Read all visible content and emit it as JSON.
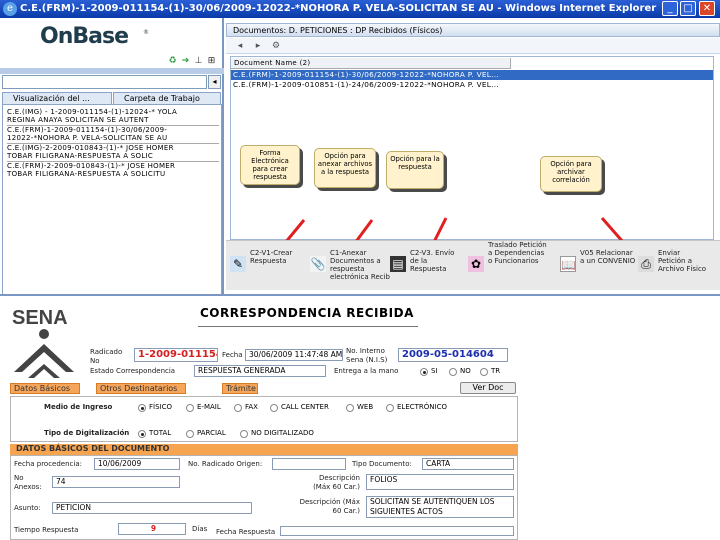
{
  "window": {
    "title": "C.E.(FRM)-1-2009-011154-(1)-30/06/2009-12022-*NOHORA P. VELA-SOLICITAN SE AU - Windows Internet Explorer",
    "icon": "ie-icon",
    "minimize": "_",
    "maximize": "□",
    "close": "✕"
  },
  "left_panel": {
    "logo": "OnBase",
    "logo_tm": "®",
    "toolbar_icons": [
      "recycle-icon",
      "arrow-right-icon",
      "doc-sort-icon",
      "pin-icon"
    ],
    "tabs": [
      "Visualización del ...",
      "Carpeta de Trabajo"
    ],
    "items": [
      [
        "C.E.(IMG) - 1-2009-011154-(1)-12024-* YOLA",
        "REGINA ANAYA SOLICITAN SE AUTENT"
      ],
      [
        "C.E.(FRM)-1-2009-011154-(1)-30/06/2009-",
        "12022-*NOHORA P. VELA-SOLICITAN SE AU"
      ],
      [
        "C.E.(IMG)-2-2009-010843-(1)-* JOSE HOMER",
        "TOBAR FILIGRANA-RESPUESTA A SOLIC"
      ],
      [
        "C.E.(FRM)-2-2009-010843-(1)-* JOSE HOMER",
        "TOBAR FILIGRANA-RESPUESTA A SOLICITU"
      ]
    ]
  },
  "right_panel": {
    "title": "Documentos: D. PETICIONES : DP Recibidos (Físicos)",
    "toolbar_icons": [
      "back-icon",
      "forward-icon",
      "settings-icon"
    ],
    "column_header": "Document Name (2)",
    "rows": [
      "C.E.(FRM)-1-2009-011154-(1)-30/06/2009-12022-*NOHORA P. VEL...",
      "C.E.(FRM)-1-2009-010851-(1)-24/06/2009-12022-*NOHORA P. VEL..."
    ],
    "callouts": [
      "Forma Electrónica para crear respuesta",
      "Opción para anexar archivos a la respuesta",
      "Opción para la respuesta",
      "Opción para archivar correlación"
    ],
    "actions": [
      {
        "label": "C2-V1-Crear Respuesta",
        "icon": "create-response-icon"
      },
      {
        "label": "C1-Anexar Documentos a respuesta electrónica Recib",
        "icon": "attach-icon"
      },
      {
        "label": "C2-V3. Envío de la Respuesta",
        "icon": "send-icon"
      },
      {
        "label": "Traslado Petición a Dependencias o Funcionarios",
        "icon": "transfer-icon"
      },
      {
        "label": "V05 Relacionar a un CONVENIO",
        "icon": "book-icon"
      },
      {
        "label": "Enviar Petición a Archivo Físico",
        "icon": "archive-icon"
      }
    ]
  },
  "form": {
    "org": "SENA",
    "title": "CORRESPONDENCIA RECIBIDA",
    "radicado_label": "Radicado No",
    "radicado_value": "1-2009-011154",
    "fecha_label": "Fecha",
    "fecha_value": "30/06/2009 11:47:48 AM",
    "interno_label": "No. Interno Sena (N.I.S)",
    "interno_value": "2009-05-014604",
    "estado_label": "Estado Correspondencia",
    "estado_value": "RESPUESTA GENERADA",
    "entrega_label": "Entrega a la mano",
    "entrega_opts": [
      "SI",
      "NO",
      "TR"
    ],
    "tabs": [
      "Datos Básicos",
      "Otros Destinatarios",
      "Trámite"
    ],
    "ver_doc": "Ver Doc",
    "medio_label": "Medio de Ingreso",
    "medio_opts": [
      "FÍSICO",
      "E-MAIL",
      "FAX",
      "CALL CENTER",
      "WEB",
      "ELECTRÓNICO"
    ],
    "tipo_label": "Tipo de Digitalización",
    "tipo_opts": [
      "TOTAL",
      "PARCIAL",
      "NO DIGITALIZADO"
    ],
    "section": "DATOS BÁSICOS DEL DOCUMENTO",
    "fecha_proc_label": "Fecha procedencia:",
    "fecha_proc_value": "10/06/2009",
    "rad_origen_label": "No. Radicado Origen:",
    "tipo_doc_label": "Tipo Documento:",
    "tipo_doc_value": "CARTA",
    "anexos_label": "No Anexos:",
    "anexos_value": "74",
    "folios_label": "Descripción (Máx 60 Car.)",
    "folios_value": "FOLIOS",
    "asunto_label": "Asunto:",
    "asunto_value": "PETICION",
    "desc_label": "Descripción (Máx 60 Car.)",
    "desc_value": "SOLICITAN SE AUTENTIQUEN LOS SIGUIENTES ACTOS",
    "tiempo_label": "Tiempo Respuesta",
    "tiempo_value": "9",
    "dias_label": "Días",
    "fecha_resp_label": "Fecha Respuesta"
  }
}
